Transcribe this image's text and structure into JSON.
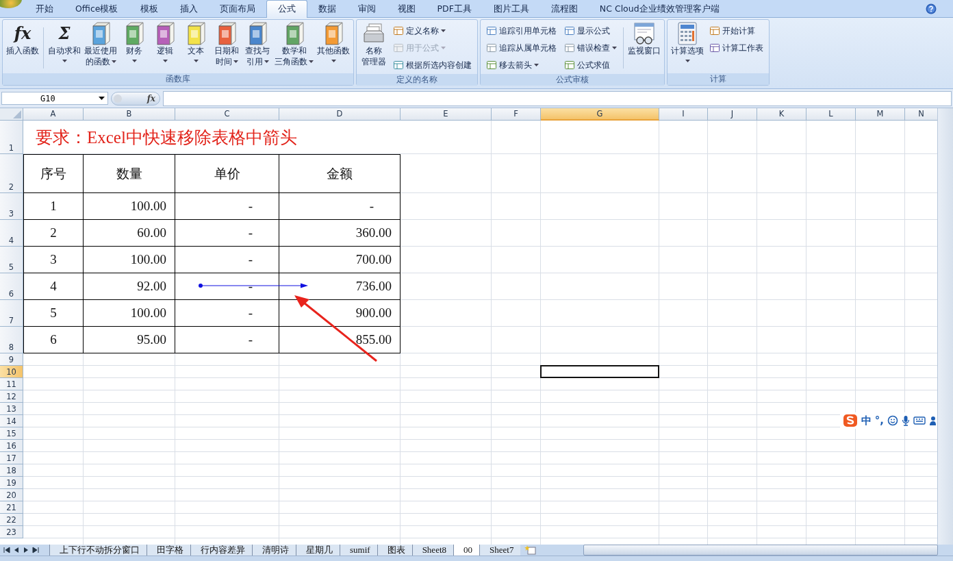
{
  "ribbon_tabs": [
    {
      "label": "开始",
      "selected": false
    },
    {
      "label": "Office模板",
      "selected": false
    },
    {
      "label": "模板",
      "selected": false
    },
    {
      "label": "插入",
      "selected": false
    },
    {
      "label": "页面布局",
      "selected": false
    },
    {
      "label": "公式",
      "selected": true
    },
    {
      "label": "数据",
      "selected": false
    },
    {
      "label": "审阅",
      "selected": false
    },
    {
      "label": "视图",
      "selected": false
    },
    {
      "label": "PDF工具",
      "selected": false
    },
    {
      "label": "图片工具",
      "selected": false
    },
    {
      "label": "流程图",
      "selected": false
    },
    {
      "label": "NC Cloud企业绩效管理客户端",
      "selected": false
    }
  ],
  "ribbon_groups": [
    {
      "title": "函数库",
      "items": [
        {
          "kind": "glyph",
          "glyph": "fx",
          "label_lines": [
            "插入函数"
          ],
          "dropdown": false
        },
        {
          "kind": "separator"
        },
        {
          "kind": "glyph",
          "glyph": "Σ",
          "label_lines": [
            "自动求和"
          ],
          "dropdown": true
        },
        {
          "kind": "book",
          "color": "#5ba3dc",
          "label_lines": [
            "最近使用",
            "的函数"
          ],
          "dropdown": true
        },
        {
          "kind": "book",
          "color": "#5faa62",
          "label_lines": [
            "财务"
          ],
          "dropdown": true
        },
        {
          "kind": "book",
          "color": "#b660b8",
          "label_lines": [
            "逻辑"
          ],
          "dropdown": true
        },
        {
          "kind": "book",
          "color": "#f2e24a",
          "label_lines": [
            "文本"
          ],
          "dropdown": true
        },
        {
          "kind": "book",
          "color": "#e8613e",
          "label_lines": [
            "日期和",
            "时间"
          ],
          "dropdown": true
        },
        {
          "kind": "book",
          "color": "#4a86cc",
          "label_lines": [
            "查找与",
            "引用"
          ],
          "dropdown": true
        },
        {
          "kind": "book",
          "color": "#62a464",
          "label_lines": [
            "数学和",
            "三角函数"
          ],
          "dropdown": true
        },
        {
          "kind": "book",
          "color": "#f39a34",
          "label_lines": [
            "其他函数"
          ],
          "dropdown": true
        }
      ]
    },
    {
      "title": "定义的名称",
      "items": [
        {
          "kind": "cards",
          "label_lines": [
            "名称",
            "管理器"
          ],
          "dropdown": false
        },
        {
          "kind": "column",
          "items": [
            {
              "label": "定义名称",
              "dropdown": true,
              "disabled": false
            },
            {
              "label": "用于公式",
              "dropdown": true,
              "disabled": true
            },
            {
              "label": "根据所选内容创建",
              "dropdown": false,
              "disabled": false
            }
          ]
        }
      ]
    },
    {
      "title": "公式审核",
      "items": [
        {
          "kind": "column",
          "items": [
            {
              "label": "追踪引用单元格",
              "dropdown": false,
              "disabled": false
            },
            {
              "label": "追踪从属单元格",
              "dropdown": false,
              "disabled": false
            },
            {
              "label": "移去箭头",
              "dropdown": true,
              "disabled": false
            }
          ]
        },
        {
          "kind": "column",
          "items": [
            {
              "label": "显示公式",
              "dropdown": false,
              "disabled": false
            },
            {
              "label": "错误检查",
              "dropdown": true,
              "disabled": false
            },
            {
              "label": "公式求值",
              "dropdown": false,
              "disabled": false
            }
          ]
        },
        {
          "kind": "separator"
        },
        {
          "kind": "watch",
          "label_lines": [
            "监视窗口"
          ],
          "dropdown": false
        }
      ]
    },
    {
      "title": "计算",
      "items": [
        {
          "kind": "calculator",
          "label_lines": [
            "计算选项"
          ],
          "dropdown": true
        },
        {
          "kind": "column",
          "items": [
            {
              "label": "开始计算",
              "dropdown": false,
              "disabled": false
            },
            {
              "label": "计算工作表",
              "dropdown": false,
              "disabled": false
            }
          ]
        }
      ]
    }
  ],
  "name_box": {
    "value": "G10"
  },
  "formula_bar": {
    "fx_label": "fx"
  },
  "columns": [
    {
      "label": "A",
      "selected": false
    },
    {
      "label": "B",
      "selected": false
    },
    {
      "label": "C",
      "selected": false
    },
    {
      "label": "D",
      "selected": false
    },
    {
      "label": "E",
      "selected": false
    },
    {
      "label": "F",
      "selected": false
    },
    {
      "label": "G",
      "selected": true
    },
    {
      "label": "I",
      "selected": false
    },
    {
      "label": "J",
      "selected": false
    },
    {
      "label": "K",
      "selected": false
    },
    {
      "label": "L",
      "selected": false
    },
    {
      "label": "M",
      "selected": false
    },
    {
      "label": "N",
      "selected": false
    }
  ],
  "rows": [
    {
      "label": "1",
      "selected": false,
      "cells": [
        {
          "text": "要求：Excel中快速移除表格中箭头",
          "kind": "title"
        }
      ]
    },
    {
      "label": "2",
      "selected": false,
      "cells": [
        {
          "text": "序号",
          "kind": "header"
        },
        {
          "text": "数量",
          "kind": "header"
        },
        {
          "text": "单价",
          "kind": "header"
        },
        {
          "text": "金额",
          "kind": "header"
        }
      ]
    },
    {
      "label": "3",
      "selected": false,
      "cells": [
        {
          "text": "1",
          "kind": "index"
        },
        {
          "text": "100.00",
          "kind": "number"
        },
        {
          "text": "-",
          "kind": "dash",
          "trace_arrow": false
        },
        {
          "text": "-",
          "kind": "dash",
          "trace_arrow": false
        }
      ]
    },
    {
      "label": "4",
      "selected": false,
      "cells": [
        {
          "text": "2",
          "kind": "index"
        },
        {
          "text": "60.00",
          "kind": "number"
        },
        {
          "text": "-",
          "kind": "dash",
          "trace_arrow": false
        },
        {
          "text": "360.00",
          "kind": "number"
        }
      ]
    },
    {
      "label": "5",
      "selected": false,
      "cells": [
        {
          "text": "3",
          "kind": "index"
        },
        {
          "text": "100.00",
          "kind": "number"
        },
        {
          "text": "-",
          "kind": "dash",
          "trace_arrow": false
        },
        {
          "text": "700.00",
          "kind": "number"
        }
      ]
    },
    {
      "label": "6",
      "selected": false,
      "cells": [
        {
          "text": "4",
          "kind": "index"
        },
        {
          "text": "92.00",
          "kind": "number"
        },
        {
          "text": "-",
          "kind": "dash",
          "trace_arrow": true
        },
        {
          "text": "736.00",
          "kind": "number"
        }
      ]
    },
    {
      "label": "7",
      "selected": false,
      "cells": [
        {
          "text": "5",
          "kind": "index"
        },
        {
          "text": "100.00",
          "kind": "number"
        },
        {
          "text": "-",
          "kind": "dash",
          "trace_arrow": false
        },
        {
          "text": "900.00",
          "kind": "number"
        }
      ]
    },
    {
      "label": "8",
      "selected": false,
      "cells": [
        {
          "text": "6",
          "kind": "index"
        },
        {
          "text": "95.00",
          "kind": "number"
        },
        {
          "text": "-",
          "kind": "dash",
          "trace_arrow": false
        },
        {
          "text": "855.00",
          "kind": "number"
        }
      ]
    },
    {
      "label": "9",
      "selected": false,
      "cells": []
    },
    {
      "label": "10",
      "selected": true,
      "cells": []
    },
    {
      "label": "11",
      "selected": false,
      "cells": []
    },
    {
      "label": "12",
      "selected": false,
      "cells": []
    },
    {
      "label": "13",
      "selected": false,
      "cells": []
    },
    {
      "label": "14",
      "selected": false,
      "cells": []
    },
    {
      "label": "15",
      "selected": false,
      "cells": []
    },
    {
      "label": "16",
      "selected": false,
      "cells": []
    },
    {
      "label": "17",
      "selected": false,
      "cells": []
    },
    {
      "label": "18",
      "selected": false,
      "cells": []
    },
    {
      "label": "19",
      "selected": false,
      "cells": []
    },
    {
      "label": "20",
      "selected": false,
      "cells": []
    },
    {
      "label": "21",
      "selected": false,
      "cells": []
    },
    {
      "label": "22",
      "selected": false,
      "cells": []
    },
    {
      "label": "23",
      "selected": false,
      "cells": []
    }
  ],
  "ime_bar": {
    "mode": "中",
    "punctuation": "°,"
  },
  "sheet_tabs": [
    {
      "label": "上下行不动拆分窗口",
      "selected": false
    },
    {
      "label": "田字格",
      "selected": false
    },
    {
      "label": "行内容差异",
      "selected": false
    },
    {
      "label": "清明诗",
      "selected": false
    },
    {
      "label": "星期几",
      "selected": false
    },
    {
      "label": "sumif",
      "selected": false
    },
    {
      "label": "图表",
      "selected": false
    },
    {
      "label": "Sheet8",
      "selected": false
    },
    {
      "label": "00",
      "selected": true
    },
    {
      "label": "Sheet7",
      "selected": false
    }
  ]
}
